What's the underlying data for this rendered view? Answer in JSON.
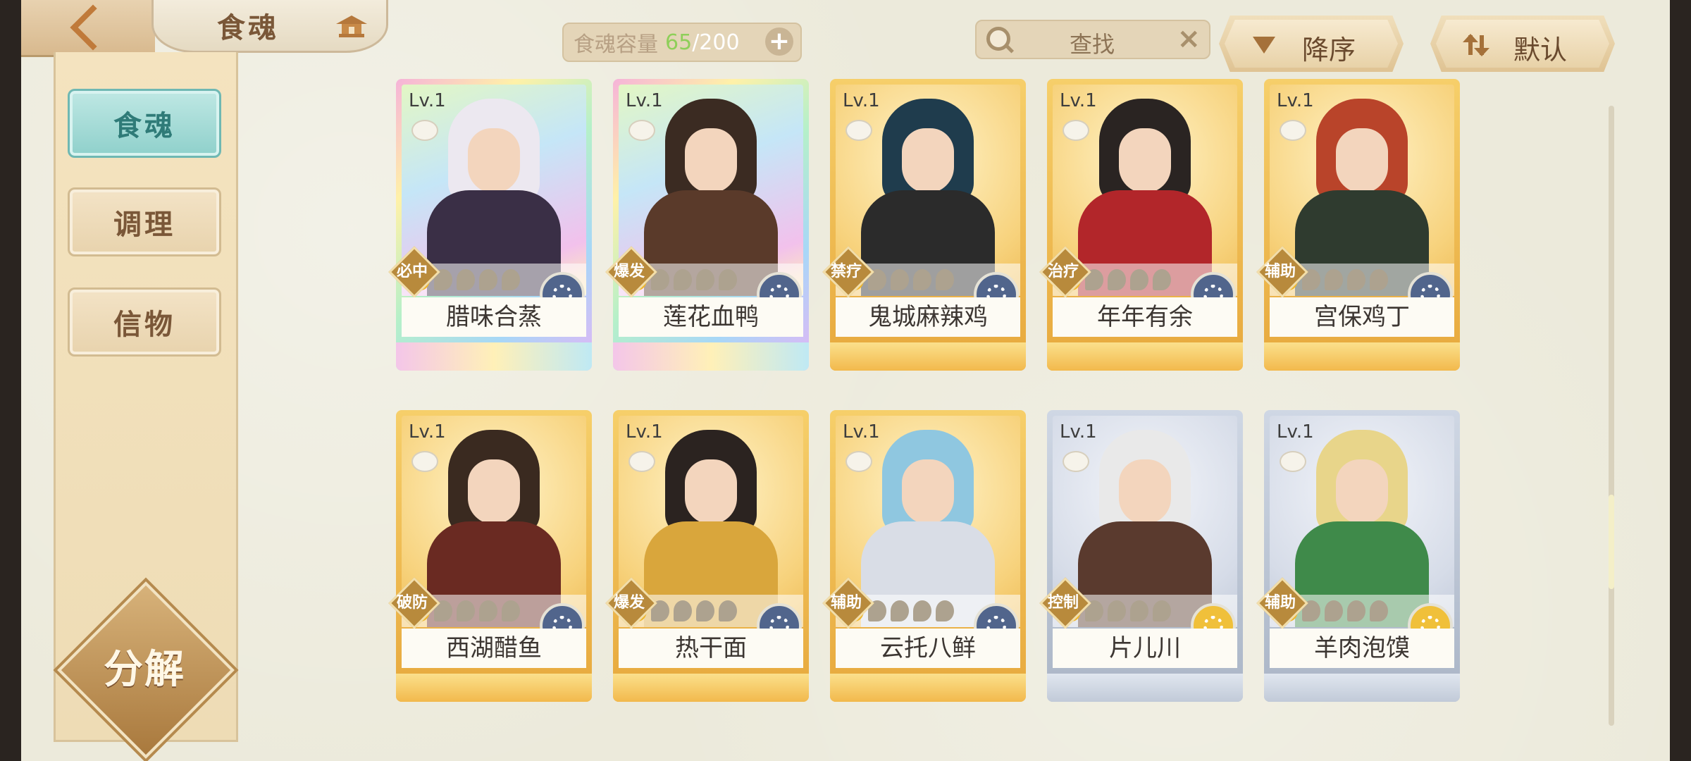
{
  "header": {
    "title": "食魂",
    "capacity": {
      "label": "食魂容量",
      "current": "65",
      "max": "/200",
      "add": "+"
    },
    "search": {
      "text": "查找",
      "clear": "×"
    },
    "sort": {
      "order_label": "降序",
      "default_label": "默认"
    }
  },
  "sidebar": {
    "tabs": [
      {
        "label": "食魂",
        "active": true
      },
      {
        "label": "调理",
        "active": false
      },
      {
        "label": "信物",
        "active": false
      }
    ],
    "decompose_label": "分解"
  },
  "cards": [
    {
      "level": "Lv.1",
      "role": "必中",
      "name": "腊味合蒸",
      "stars_on": 1,
      "stars_total": 5,
      "frame": "rainbow",
      "element": "blue"
    },
    {
      "level": "Lv.1",
      "role": "爆发",
      "name": "莲花血鸭",
      "stars_on": 1,
      "stars_total": 5,
      "frame": "rainbow",
      "element": "blue"
    },
    {
      "level": "Lv.1",
      "role": "禁疗",
      "name": "鬼城麻辣鸡",
      "stars_on": 1,
      "stars_total": 5,
      "frame": "gold",
      "element": "blue"
    },
    {
      "level": "Lv.1",
      "role": "治疗",
      "name": "年年有余",
      "stars_on": 1,
      "stars_total": 5,
      "frame": "gold",
      "element": "blue"
    },
    {
      "level": "Lv.1",
      "role": "辅助",
      "name": "宫保鸡丁",
      "stars_on": 1,
      "stars_total": 5,
      "frame": "gold",
      "element": "blue"
    },
    {
      "level": "Lv.1",
      "role": "破防",
      "name": "西湖醋鱼",
      "stars_on": 1,
      "stars_total": 5,
      "frame": "gold",
      "element": "blue"
    },
    {
      "level": "Lv.1",
      "role": "爆发",
      "name": "热干面",
      "stars_on": 1,
      "stars_total": 5,
      "frame": "gold",
      "element": "blue"
    },
    {
      "level": "Lv.1",
      "role": "辅助",
      "name": "云托八鲜",
      "stars_on": 1,
      "stars_total": 5,
      "frame": "gold",
      "element": "blue"
    },
    {
      "level": "Lv.1",
      "role": "控制",
      "name": "片儿川",
      "stars_on": 1,
      "stars_total": 5,
      "frame": "silver",
      "element": "gold"
    },
    {
      "level": "Lv.1",
      "role": "辅助",
      "name": "羊肉泡馍",
      "stars_on": 1,
      "stars_total": 5,
      "frame": "silver",
      "element": "gold"
    }
  ],
  "colors": {
    "capacity_current": "#8fcf5a",
    "active_tab": "#8fd0cb",
    "gold_frame": "#f6cf6a",
    "silver_frame": "#cfd7e4"
  }
}
